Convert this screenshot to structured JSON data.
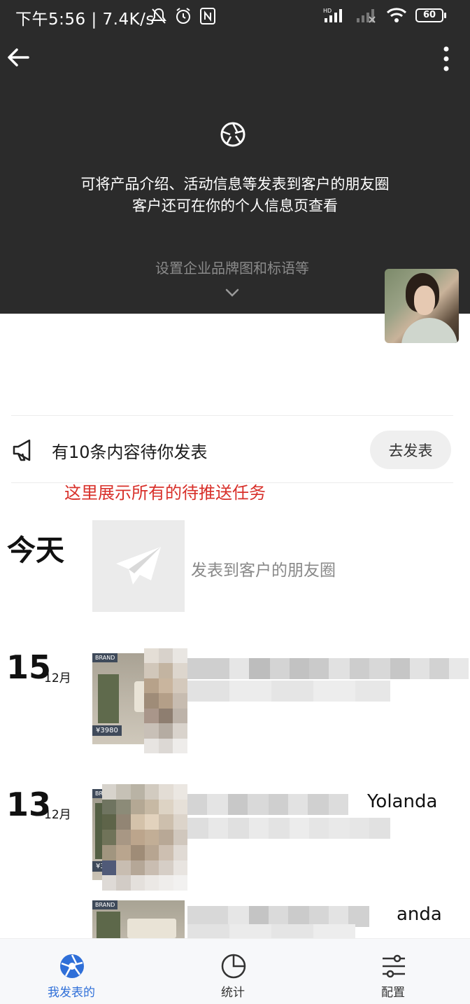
{
  "status_bar": {
    "time_speed": "下午5:56 | 7.4K/s",
    "network_label": "HD",
    "battery": "60"
  },
  "header": {
    "intro_line1": "可将产品介绍、活动信息等发表到客户的朋友圈",
    "intro_line2": "客户还可在你的个人信息页查看",
    "brand_setting": "设置企业品牌图和标语等"
  },
  "pending": {
    "text": "有10条内容待你发表",
    "button": "去发表"
  },
  "annotation": "这里展示所有的待推送任务",
  "timeline": {
    "today": {
      "label": "今天",
      "publish_text": "发表到客户的朋友圈"
    },
    "entries": [
      {
        "day": "15",
        "month": "12月",
        "brand": "BRAND",
        "price": "¥3980",
        "author": ""
      },
      {
        "day": "13",
        "month": "12月",
        "brand": "BRAND",
        "price": "¥39",
        "author": "Yolanda"
      },
      {
        "day": "",
        "month": "",
        "brand": "BRAND",
        "price": "",
        "author": "anda"
      }
    ]
  },
  "tabbar": {
    "tabs": [
      {
        "label": "我发表的",
        "icon": "aperture-icon",
        "active": true
      },
      {
        "label": "统计",
        "icon": "clock-icon",
        "active": false
      },
      {
        "label": "配置",
        "icon": "sliders-icon",
        "active": false
      }
    ]
  },
  "colors": {
    "header_bg": "#2b2b2b",
    "accent": "#2f6fd8",
    "annotation": "#d8302a"
  }
}
